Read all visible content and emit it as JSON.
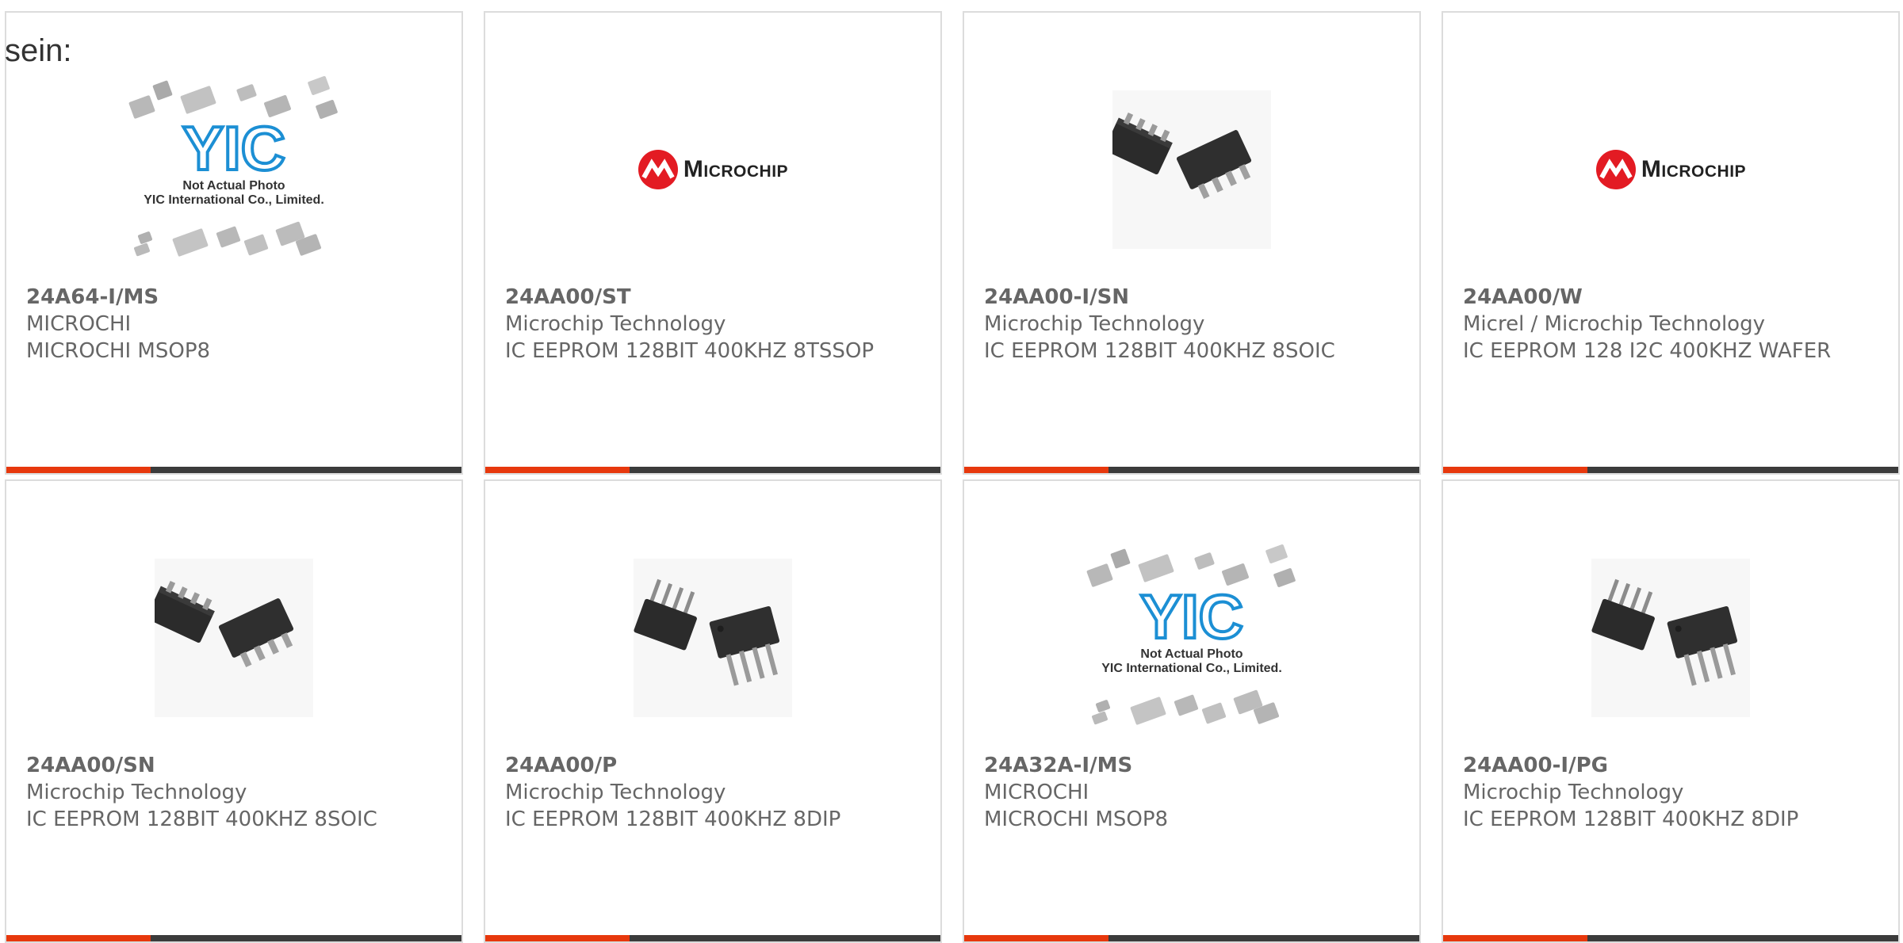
{
  "lead_text": "sein:",
  "colors": {
    "accent": "#e7380d",
    "bar_dark": "#3b3b3b",
    "brand_red": "#e31b23",
    "yic_blue": "#1c8fd4"
  },
  "placeholder_image": {
    "line1": "Not Actual Photo",
    "line2": "YIC International Co., Limited."
  },
  "microchip_logo": {
    "text": "Microchip"
  },
  "products": [
    {
      "part": "24A64-I/MS",
      "mfr": "MICROCHI",
      "desc": "MICROCHI MSOP8",
      "image": "yic-placeholder"
    },
    {
      "part": "24AA00/ST",
      "mfr": "Microchip Technology",
      "desc": "IC EEPROM 128BIT 400KHZ 8TSSOP",
      "image": "microchip-logo"
    },
    {
      "part": "24AA00-I/SN",
      "mfr": "Microchip Technology",
      "desc": "IC EEPROM 128BIT 400KHZ 8SOIC",
      "image": "soic-8-chip"
    },
    {
      "part": "24AA00/W",
      "mfr": "Micrel / Microchip Technology",
      "desc": "IC EEPROM 128 I2C 400KHZ WAFER",
      "image": "microchip-logo"
    },
    {
      "part": "24AA00/SN",
      "mfr": "Microchip Technology",
      "desc": "IC EEPROM 128BIT 400KHZ 8SOIC",
      "image": "soic-8-chip"
    },
    {
      "part": "24AA00/P",
      "mfr": "Microchip Technology",
      "desc": "IC EEPROM 128BIT 400KHZ 8DIP",
      "image": "dip-8-chip"
    },
    {
      "part": "24A32A-I/MS",
      "mfr": "MICROCHI",
      "desc": "MICROCHI MSOP8",
      "image": "yic-placeholder"
    },
    {
      "part": "24AA00-I/PG",
      "mfr": "Microchip Technology",
      "desc": "IC EEPROM 128BIT 400KHZ 8DIP",
      "image": "dip-8-chip"
    }
  ]
}
